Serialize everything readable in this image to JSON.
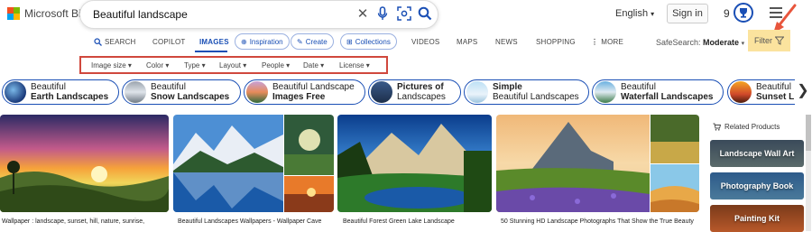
{
  "header": {
    "brand": "Microsoft Bing",
    "search_query": "Beautiful landscape",
    "language": "English",
    "signin_label": "Sign in",
    "rewards_count": "9"
  },
  "nav": {
    "tabs": [
      {
        "label": "SEARCH"
      },
      {
        "label": "COPILOT"
      },
      {
        "label": "IMAGES"
      },
      {
        "label": "Inspiration"
      },
      {
        "label": "Create"
      },
      {
        "label": "Collections"
      },
      {
        "label": "VIDEOS"
      },
      {
        "label": "MAPS"
      },
      {
        "label": "NEWS"
      },
      {
        "label": "SHOPPING"
      },
      {
        "label": "MORE"
      }
    ],
    "safesearch_label": "SafeSearch:",
    "safesearch_value": "Moderate",
    "filter_label": "Filter"
  },
  "filters": [
    {
      "label": "Image size"
    },
    {
      "label": "Color"
    },
    {
      "label": "Type"
    },
    {
      "label": "Layout"
    },
    {
      "label": "People"
    },
    {
      "label": "Date"
    },
    {
      "label": "License"
    }
  ],
  "related": [
    {
      "line1": "Beautiful",
      "line2": "Earth Landscapes",
      "bold": 2
    },
    {
      "line1": "Beautiful",
      "line2": "Snow Landscapes",
      "bold": 2
    },
    {
      "line1": "Beautiful Landscape",
      "line2": "Images Free",
      "bold": 2
    },
    {
      "line1": "Pictures of",
      "line2": "Landscapes",
      "bold": 1
    },
    {
      "line1": "Simple",
      "line2": "Beautiful Landscapes",
      "bold": 1
    },
    {
      "line1": "Beautiful",
      "line2": "Waterfall Landscapes",
      "bold": 2
    },
    {
      "line1": "Beautiful",
      "line2": "Sunset L",
      "bold": 2
    }
  ],
  "results": [
    {
      "caption": "Wallpaper : landscape, sunset, hill, nature, sunrise,"
    },
    {
      "caption": "Beautiful Landscapes Wallpapers - Wallpaper Cave"
    },
    {
      "caption": "Beautiful Forest Green Lake Landscape"
    },
    {
      "caption": "50 Stunning HD Landscape Photographs That Show the True Beauty"
    }
  ],
  "sidebar": {
    "title": "Related Products",
    "products": [
      {
        "label": "Landscape Wall Art"
      },
      {
        "label": "Photography Book"
      },
      {
        "label": "Painting Kit"
      }
    ]
  }
}
